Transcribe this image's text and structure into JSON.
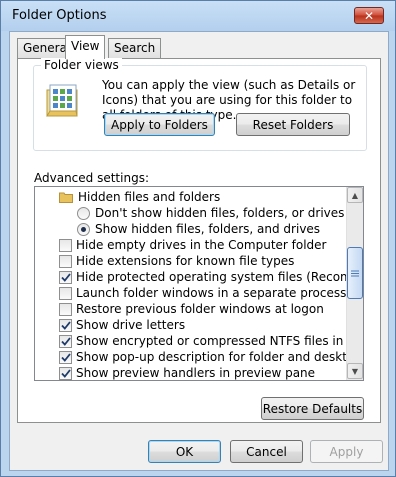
{
  "window": {
    "title": "Folder Options",
    "close_glyph": "✕"
  },
  "tabs": [
    {
      "label": "General",
      "active": false
    },
    {
      "label": "View",
      "active": true
    },
    {
      "label": "Search",
      "active": false
    }
  ],
  "folder_views": {
    "group_label": "Folder views",
    "description": "You can apply the view (such as Details or Icons) that you are using for this folder to all folders of this type.",
    "icon": "folder-views-icon",
    "apply_button": "Apply to Folders",
    "reset_button": "Reset Folders"
  },
  "advanced": {
    "label": "Advanced settings:",
    "items": [
      {
        "type": "folder",
        "label": "Hidden files and folders"
      },
      {
        "type": "radio",
        "label": "Don't show hidden files, folders, or drives",
        "checked": false
      },
      {
        "type": "radio",
        "label": "Show hidden files, folders, and drives",
        "checked": true
      },
      {
        "type": "checkbox",
        "label": "Hide empty drives in the Computer folder",
        "checked": false
      },
      {
        "type": "checkbox",
        "label": "Hide extensions for known file types",
        "checked": false
      },
      {
        "type": "checkbox",
        "label": "Hide protected operating system files (Recommended)",
        "checked": true
      },
      {
        "type": "checkbox",
        "label": "Launch folder windows in a separate process",
        "checked": false
      },
      {
        "type": "checkbox",
        "label": "Restore previous folder windows at logon",
        "checked": false
      },
      {
        "type": "checkbox",
        "label": "Show drive letters",
        "checked": true
      },
      {
        "type": "checkbox",
        "label": "Show encrypted or compressed NTFS files in color",
        "checked": true
      },
      {
        "type": "checkbox",
        "label": "Show pop-up description for folder and desktop items",
        "checked": true
      },
      {
        "type": "checkbox",
        "label": "Show preview handlers in preview pane",
        "checked": true
      }
    ],
    "restore_button": "Restore Defaults"
  },
  "footer": {
    "ok": "OK",
    "cancel": "Cancel",
    "apply": "Apply"
  },
  "colors": {
    "frame": "#bcd5ee",
    "face": "#f0f0f0",
    "check": "#1f3b6a",
    "folder": "#e8c25c"
  }
}
